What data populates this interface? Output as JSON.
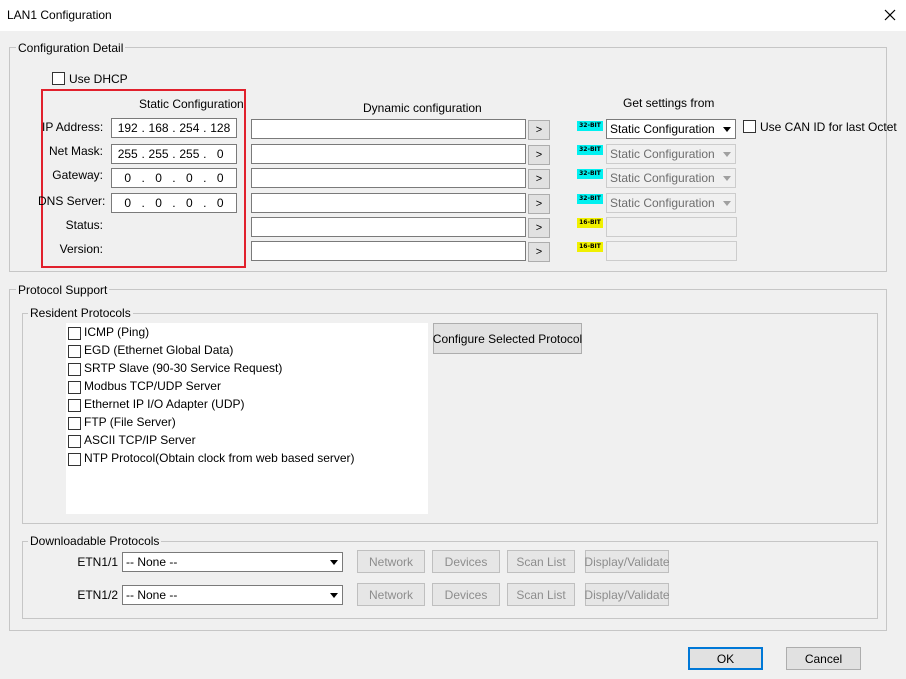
{
  "window": {
    "title": "LAN1 Configuration",
    "close_glyph": "✕"
  },
  "config_detail": {
    "group_label": "Configuration Detail",
    "use_dhcp_label": "Use DHCP",
    "static_header": "Static Configuration",
    "dynamic_header": "Dynamic configuration",
    "get_settings_header": "Get settings from",
    "use_can_id_label": "Use CAN ID for last Octet",
    "rows": [
      {
        "label": "IP Address:",
        "octets": [
          "192",
          "168",
          "254",
          "128"
        ],
        "badge": "32-BIT",
        "source": "Static Configuration",
        "source_enabled": true
      },
      {
        "label": "Net Mask:",
        "octets": [
          "255",
          "255",
          "255",
          "0"
        ],
        "badge": "32-BIT",
        "source": "Static Configuration",
        "source_enabled": false
      },
      {
        "label": "Gateway:",
        "octets": [
          "0",
          "0",
          "0",
          "0"
        ],
        "badge": "32-BIT",
        "source": "Static Configuration",
        "source_enabled": false
      },
      {
        "label": "DNS Server:",
        "octets": [
          "0",
          "0",
          "0",
          "0"
        ],
        "badge": "32-BIT",
        "source": "Static Configuration",
        "source_enabled": false
      },
      {
        "label": "Status:",
        "badge": "16-BIT"
      },
      {
        "label": "Version:",
        "badge": "16-BIT"
      }
    ],
    "arrow_glyph": ">"
  },
  "protocol_support": {
    "group_label": "Protocol Support",
    "resident_label": "Resident Protocols",
    "protocols": [
      "ICMP (Ping)",
      "EGD (Ethernet Global Data)",
      "SRTP Slave (90-30 Service Request)",
      "Modbus TCP/UDP Server",
      "Ethernet IP I/O Adapter (UDP)",
      "FTP (File Server)",
      "ASCII TCP/IP Server",
      "NTP Protocol(Obtain clock from web based server)"
    ],
    "configure_button": "Configure Selected Protocol",
    "downloadable_label": "Downloadable Protocols",
    "etn_rows": [
      {
        "label": "ETN1/1",
        "value": "-- None --"
      },
      {
        "label": "ETN1/2",
        "value": "-- None --"
      }
    ],
    "etn_buttons": [
      "Network",
      "Devices",
      "Scan List",
      "Display/Validate"
    ]
  },
  "footer": {
    "ok": "OK",
    "cancel": "Cancel"
  },
  "colors": {
    "badge32": "#00f0f0",
    "badge16": "#f0f000",
    "highlight": "#e1202c"
  }
}
